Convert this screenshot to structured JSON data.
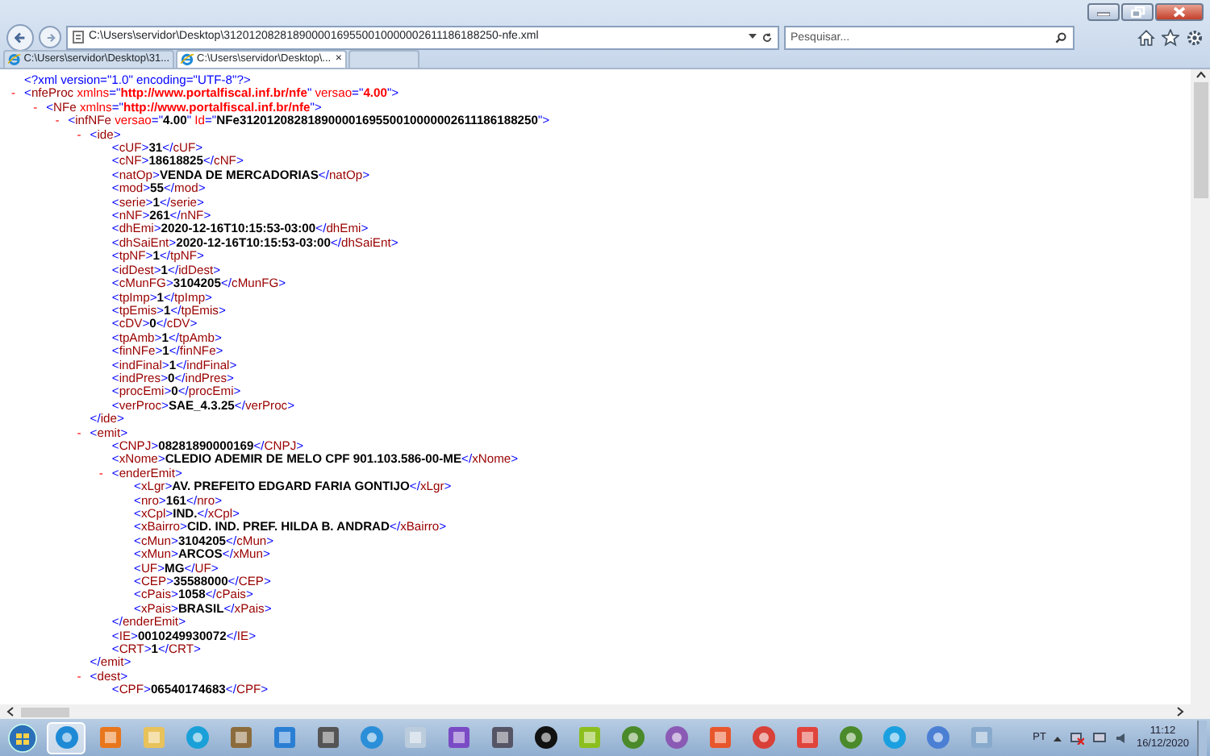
{
  "address_bar": {
    "url": "C:\\Users\\servidor\\Desktop\\31201208281890000169550010000002611186188250-nfe.xml"
  },
  "search": {
    "placeholder": "Pesquisar..."
  },
  "tabs": [
    {
      "label": "C:\\Users\\servidor\\Desktop\\31...",
      "selected": false
    },
    {
      "label": "C:\\Users\\servidor\\Desktop\\...",
      "selected": true,
      "close": "×"
    }
  ],
  "document": {
    "declaration": "<?xml version=\"1.0\" encoding=\"UTF-8\"?>",
    "root": {
      "toggle": "-",
      "open": "<nfeProc",
      "attributes": [
        {
          "name": " xmlns=",
          "value": "\"http://www.portalfiscal.inf.br/nfe\"",
          "kind": "namespace"
        },
        {
          "name": " versao=",
          "value": "\"4.00\"",
          "kind": "namespace"
        }
      ],
      "open_end": ">",
      "children": [
        {
          "toggle": "-",
          "open": "<NFe",
          "attributes": [
            {
              "name": " xmlns=",
              "value": "\"http://www.portalfiscal.inf.br/nfe\"",
              "kind": "namespace"
            }
          ],
          "open_end": ">",
          "children": [
            {
              "toggle": "-",
              "open": "<infNFe",
              "attributes": [
                {
                  "name": " versao=",
                  "value": "\"4.00\"",
                  "kind": "plain"
                },
                {
                  "name": " Id=",
                  "value": "\"NFe31201208281890000169550010000002611186188250\"",
                  "kind": "plain"
                }
              ],
              "open_end": ">",
              "children": [
                {
                  "toggle": "-",
                  "open": "<ide",
                  "open_end": ">",
                  "close": "</ide>",
                  "children": [
                    {
                      "open": "<cUF>",
                      "value": "31",
                      "close": "</cUF>"
                    },
                    {
                      "open": "<cNF>",
                      "value": "18618825",
                      "close": "</cNF>"
                    },
                    {
                      "open": "<natOp>",
                      "value": "VENDA DE MERCADORIAS",
                      "close": "</natOp>"
                    },
                    {
                      "open": "<mod>",
                      "value": "55",
                      "close": "</mod>"
                    },
                    {
                      "open": "<serie>",
                      "value": "1",
                      "close": "</serie>"
                    },
                    {
                      "open": "<nNF>",
                      "value": "261",
                      "close": "</nNF>"
                    },
                    {
                      "open": "<dhEmi>",
                      "value": "2020-12-16T10:15:53-03:00",
                      "close": "</dhEmi>"
                    },
                    {
                      "open": "<dhSaiEnt>",
                      "value": "2020-12-16T10:15:53-03:00",
                      "close": "</dhSaiEnt>"
                    },
                    {
                      "open": "<tpNF>",
                      "value": "1",
                      "close": "</tpNF>"
                    },
                    {
                      "open": "<idDest>",
                      "value": "1",
                      "close": "</idDest>"
                    },
                    {
                      "open": "<cMunFG>",
                      "value": "3104205",
                      "close": "</cMunFG>"
                    },
                    {
                      "open": "<tpImp>",
                      "value": "1",
                      "close": "</tpImp>"
                    },
                    {
                      "open": "<tpEmis>",
                      "value": "1",
                      "close": "</tpEmis>"
                    },
                    {
                      "open": "<cDV>",
                      "value": "0",
                      "close": "</cDV>"
                    },
                    {
                      "open": "<tpAmb>",
                      "value": "1",
                      "close": "</tpAmb>"
                    },
                    {
                      "open": "<finNFe>",
                      "value": "1",
                      "close": "</finNFe>"
                    },
                    {
                      "open": "<indFinal>",
                      "value": "1",
                      "close": "</indFinal>"
                    },
                    {
                      "open": "<indPres>",
                      "value": "0",
                      "close": "</indPres>"
                    },
                    {
                      "open": "<procEmi>",
                      "value": "0",
                      "close": "</procEmi>"
                    },
                    {
                      "open": "<verProc>",
                      "value": "SAE_4.3.25",
                      "close": "</verProc>"
                    }
                  ]
                },
                {
                  "toggle": "-",
                  "open": "<emit",
                  "open_end": ">",
                  "close": "</emit>",
                  "children": [
                    {
                      "open": "<CNPJ>",
                      "value": "08281890000169",
                      "close": "</CNPJ>"
                    },
                    {
                      "open": "<xNome>",
                      "value": "CLEDIO ADEMIR DE MELO CPF 901.103.586-00-ME",
                      "close": "</xNome>"
                    },
                    {
                      "toggle": "-",
                      "open": "<enderEmit",
                      "open_end": ">",
                      "close": "</enderEmit>",
                      "children": [
                        {
                          "open": "<xLgr>",
                          "value": "AV. PREFEITO EDGARD FARIA GONTIJO",
                          "close": "</xLgr>"
                        },
                        {
                          "open": "<nro>",
                          "value": "161",
                          "close": "</nro>"
                        },
                        {
                          "open": "<xCpl>",
                          "value": "IND.",
                          "close": "</xCpl>"
                        },
                        {
                          "open": "<xBairro>",
                          "value": "CID. IND. PREF. HILDA B. ANDRAD",
                          "close": "</xBairro>"
                        },
                        {
                          "open": "<cMun>",
                          "value": "3104205",
                          "close": "</cMun>"
                        },
                        {
                          "open": "<xMun>",
                          "value": "ARCOS",
                          "close": "</xMun>"
                        },
                        {
                          "open": "<UF>",
                          "value": "MG",
                          "close": "</UF>"
                        },
                        {
                          "open": "<CEP>",
                          "value": "35588000",
                          "close": "</CEP>"
                        },
                        {
                          "open": "<cPais>",
                          "value": "1058",
                          "close": "</cPais>"
                        },
                        {
                          "open": "<xPais>",
                          "value": "BRASIL",
                          "close": "</xPais>"
                        }
                      ]
                    },
                    {
                      "open": "<IE>",
                      "value": "0010249930072",
                      "close": "</IE>"
                    },
                    {
                      "open": "<CRT>",
                      "value": "1",
                      "close": "</CRT>"
                    }
                  ]
                },
                {
                  "toggle": "-",
                  "open": "<dest",
                  "open_end": ">",
                  "children": [
                    {
                      "open": "<CPF>",
                      "value": "06540174683",
                      "close": "</CPF>"
                    }
                  ]
                }
              ]
            }
          ]
        }
      ]
    }
  },
  "taskbar": {
    "language": "PT",
    "time": "11:12",
    "date": "16/12/2020"
  }
}
